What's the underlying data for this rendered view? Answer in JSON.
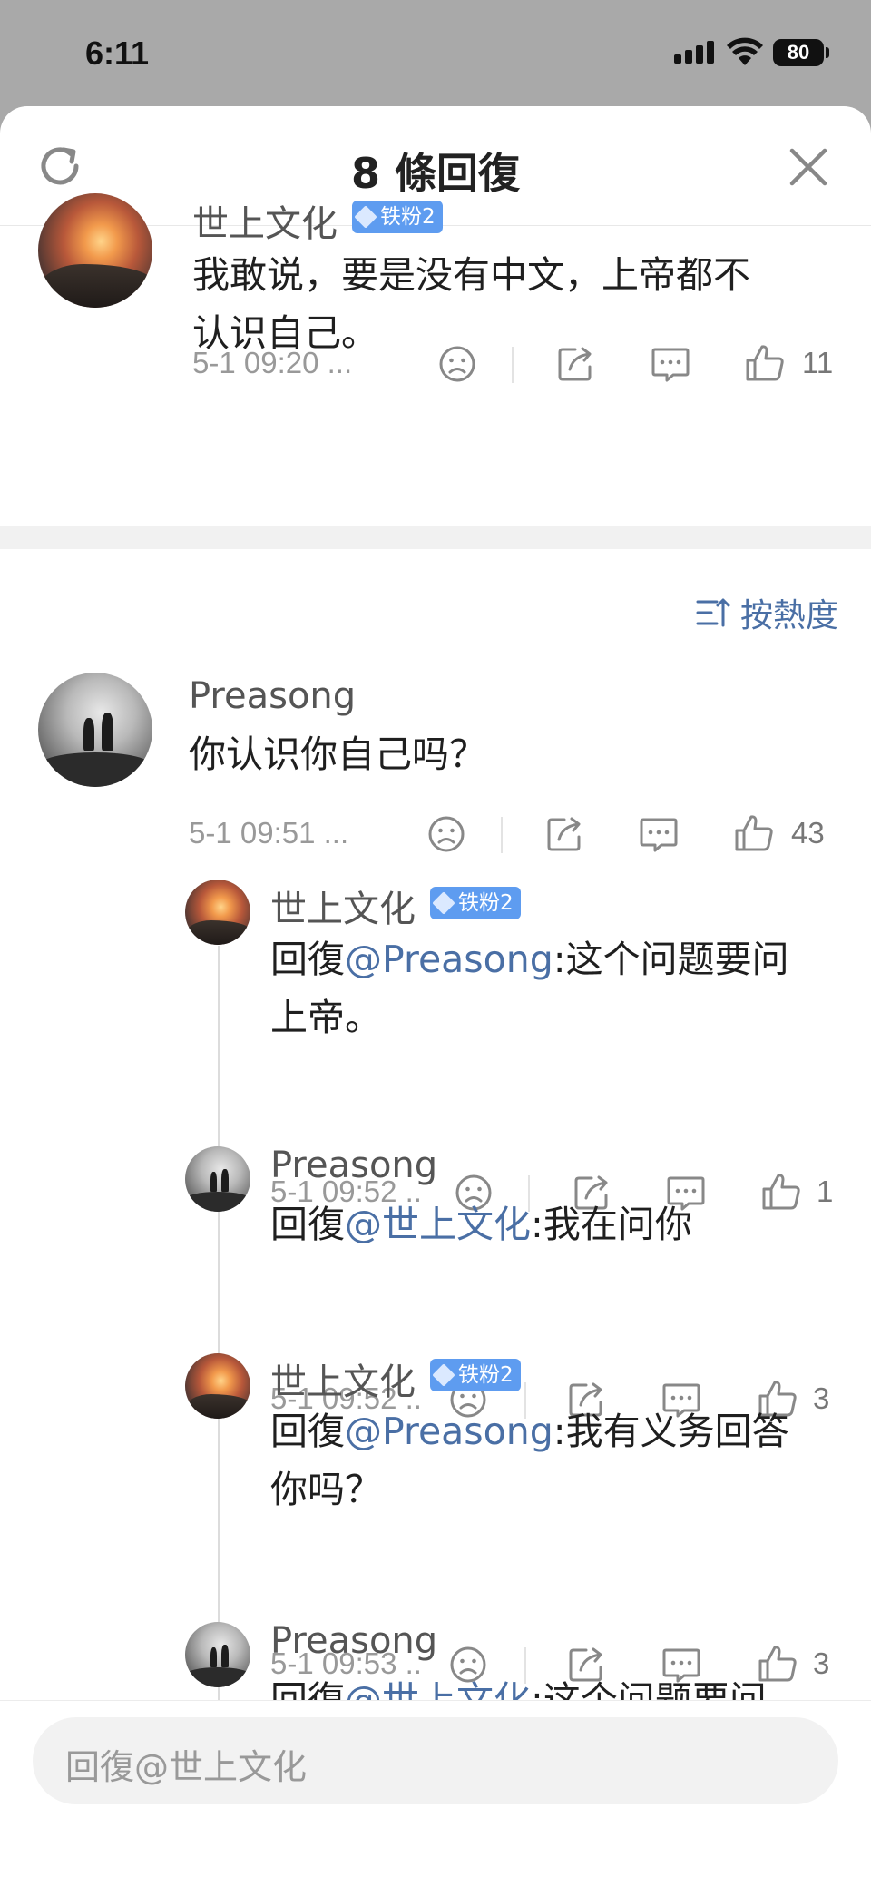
{
  "status_bar": {
    "time": "6:11",
    "battery": "80"
  },
  "header": {
    "title": "8 條回復"
  },
  "main_comment": {
    "author": "世上文化",
    "badge": "铁粉2",
    "text_line1": "我敢说，要是没有中文，上帝都不",
    "text_line2": "认识自己。",
    "time": "5-1 09:20 ...",
    "likes": "11"
  },
  "sort": {
    "label": "按熱度"
  },
  "replies": [
    {
      "author": "Preasong",
      "text": "你认识你自己吗？",
      "time": "5-1 09:51 ...",
      "likes": "43"
    },
    {
      "author": "世上文化",
      "badge": "铁粉2",
      "prefix": "回復",
      "mention": "@Preasong",
      "text_rest": ":这个问题要问",
      "text_line2": "上帝。",
      "time": "5-1 09:52 ..",
      "likes": "1"
    },
    {
      "author": "Preasong",
      "prefix": "回復",
      "mention": "@世上文化",
      "text_rest": ":我在问你",
      "time": "5-1 09:52 ..",
      "likes": "3"
    },
    {
      "author": "世上文化",
      "badge": "铁粉2",
      "prefix": "回復",
      "mention": "@Preasong",
      "text_rest": ":我有义务回答",
      "text_line2": "你吗？",
      "time": "5-1 09:53 ..",
      "likes": "3"
    },
    {
      "author": "Preasong",
      "prefix": "回復",
      "mention": "@世上文化",
      "text_rest": ":这个问题要问"
    }
  ],
  "footer": {
    "placeholder": "回復@世上文化"
  },
  "colors": {
    "mention": "#4a6fa5",
    "badge": "#5e9cf0",
    "background_dim": "#a9a9a9"
  }
}
